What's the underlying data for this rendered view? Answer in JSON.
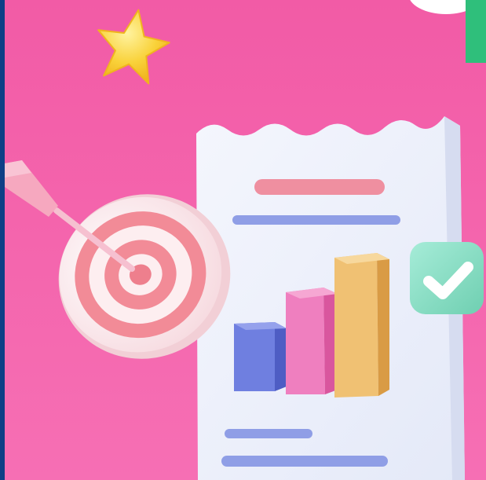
{
  "scene": {
    "description_labels": [],
    "colors": {
      "frame": "#0e3f86",
      "background_top": "#f25ba6",
      "background_bottom": "#f66fb4",
      "paper": "#eef1fb",
      "star": "#f9d23a",
      "check_badge": "#8fe0c8",
      "green_corner": "#2fbf7b",
      "bar_blue": "#6f7fe0",
      "bar_pink": "#ef7fbf",
      "bar_yellow": "#f0c173",
      "line_pink": "#ef8fa0",
      "line_blue": "#8f9ee6",
      "target_red": "#f28b97",
      "target_white": "#fdeef0",
      "dart_pink": "#f6a8bf"
    },
    "icons": [
      "star-icon",
      "check-icon",
      "target-icon",
      "dart-icon",
      "bar-chart-icon"
    ]
  }
}
